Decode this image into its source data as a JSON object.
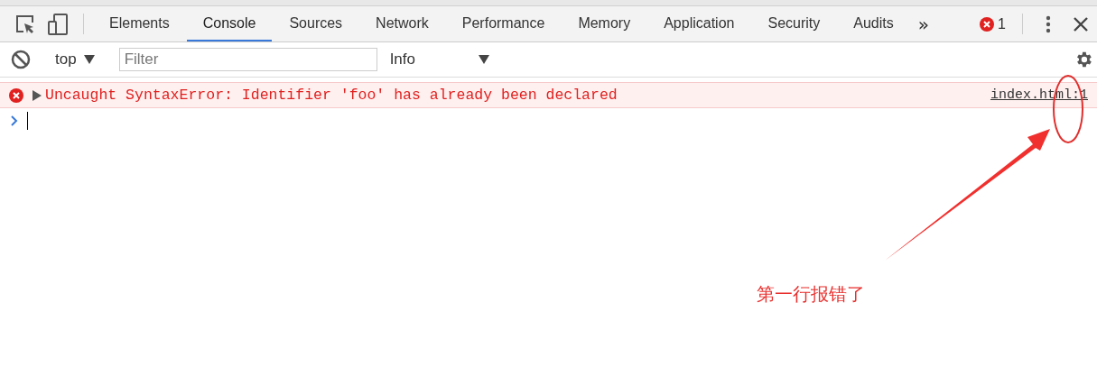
{
  "tabs": [
    {
      "label": "Elements",
      "selected": false
    },
    {
      "label": "Console",
      "selected": true
    },
    {
      "label": "Sources",
      "selected": false
    },
    {
      "label": "Network",
      "selected": false
    },
    {
      "label": "Performance",
      "selected": false
    },
    {
      "label": "Memory",
      "selected": false
    },
    {
      "label": "Application",
      "selected": false
    },
    {
      "label": "Security",
      "selected": false
    },
    {
      "label": "Audits",
      "selected": false
    }
  ],
  "more_tabs": "»",
  "error_count": "1",
  "toolbar": {
    "context": "top",
    "filter": {
      "placeholder": "Filter"
    },
    "level": "Info"
  },
  "messages": [
    {
      "kind": "error",
      "text": "Uncaught SyntaxError: Identifier 'foo' has already been declared",
      "source": "index.html:1"
    }
  ],
  "annotation": {
    "text": "第一行报错了"
  }
}
